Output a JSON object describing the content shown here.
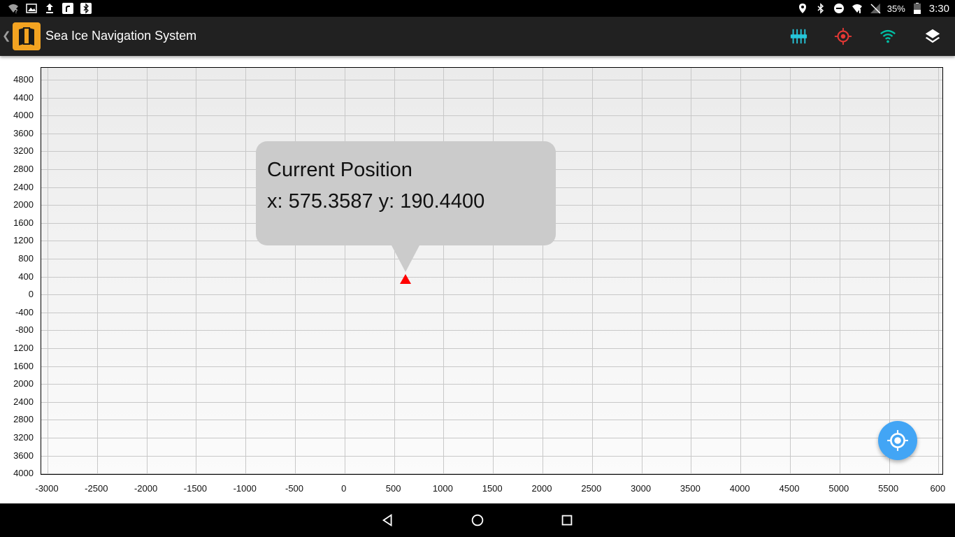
{
  "status_bar": {
    "battery": "35%",
    "time": "3:30",
    "left_icons": [
      "wifi-question-icon",
      "image-icon",
      "upload-icon",
      "app-r-icon",
      "bluetooth-icon"
    ],
    "right_icons": [
      "location-pin-icon",
      "bluetooth-icon",
      "do-not-disturb-icon",
      "wifi-off-icon",
      "sim-off-icon",
      "battery-icon"
    ]
  },
  "app_bar": {
    "title": "Sea Ice Navigation System",
    "back_icon": "chevron-left-icon",
    "logo_icon": "map-book-icon",
    "actions": [
      {
        "name": "sensors-button",
        "icon": "sliders-icon",
        "color": "#26c6da"
      },
      {
        "name": "target-button",
        "icon": "crosshair-icon",
        "color": "#e53935"
      },
      {
        "name": "wifi-button",
        "icon": "wifi-icon",
        "color": "#00bfa5"
      },
      {
        "name": "layers-button",
        "icon": "layers-icon",
        "color": "#ffffff"
      }
    ]
  },
  "plot": {
    "y_ticks": [
      "4800",
      "4400",
      "4000",
      "3600",
      "3200",
      "2800",
      "2400",
      "2000",
      "1600",
      "1200",
      "800",
      "400",
      "0",
      "-400",
      "-800",
      "1200",
      "1600",
      "2000",
      "2400",
      "2800",
      "3200",
      "3600",
      "4000"
    ],
    "x_ticks": [
      "-3000",
      "-2500",
      "-2000",
      "-1500",
      "-1000",
      "-500",
      "0",
      "500",
      "1000",
      "1500",
      "2000",
      "2500",
      "3000",
      "3500",
      "4000",
      "4500",
      "5000",
      "5500",
      "600"
    ],
    "grid": true,
    "marker_color": "#ff0000"
  },
  "callout": {
    "title": "Current Position",
    "coords": "x: 575.3587 y: 190.4400"
  },
  "fab": {
    "icon": "my-location-icon",
    "color": "#42a5f5"
  },
  "nav_bar": {
    "icons": [
      "back-triangle-icon",
      "home-circle-icon",
      "recents-square-icon"
    ]
  }
}
